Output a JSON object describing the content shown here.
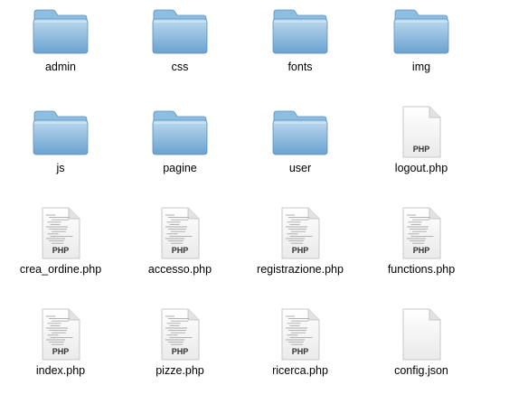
{
  "items": [
    {
      "label": "admin",
      "type": "folder"
    },
    {
      "label": "css",
      "type": "folder"
    },
    {
      "label": "fonts",
      "type": "folder"
    },
    {
      "label": "img",
      "type": "folder"
    },
    {
      "label": "js",
      "type": "folder"
    },
    {
      "label": "pagine",
      "type": "folder"
    },
    {
      "label": "user",
      "type": "folder"
    },
    {
      "label": "logout.php",
      "type": "php",
      "badge": "PHP"
    },
    {
      "label": "crea_ordine.php",
      "type": "php",
      "badge": "PHP"
    },
    {
      "label": "accesso.php",
      "type": "php",
      "badge": "PHP"
    },
    {
      "label": "registrazione.php",
      "type": "php",
      "badge": "PHP"
    },
    {
      "label": "functions.php",
      "type": "php",
      "badge": "PHP"
    },
    {
      "label": "index.php",
      "type": "php",
      "badge": "PHP"
    },
    {
      "label": "pizze.php",
      "type": "php",
      "badge": "PHP"
    },
    {
      "label": "ricerca.php",
      "type": "php",
      "badge": "PHP"
    },
    {
      "label": "config.json",
      "type": "json"
    }
  ],
  "colors": {
    "folder_top": "#bcd9ef",
    "folder_bottom": "#6aa2cf",
    "folder_tab": "#8ebde2",
    "folder_edge": "#5b8fbd",
    "doc_fill": "#f7f7f7",
    "doc_edge": "#c7c7c7",
    "code_lines": "#a9a9a9",
    "badge_text": "#333333"
  },
  "icons": {
    "folder": "folder-icon",
    "php": "php-file-icon",
    "json": "json-file-icon"
  }
}
